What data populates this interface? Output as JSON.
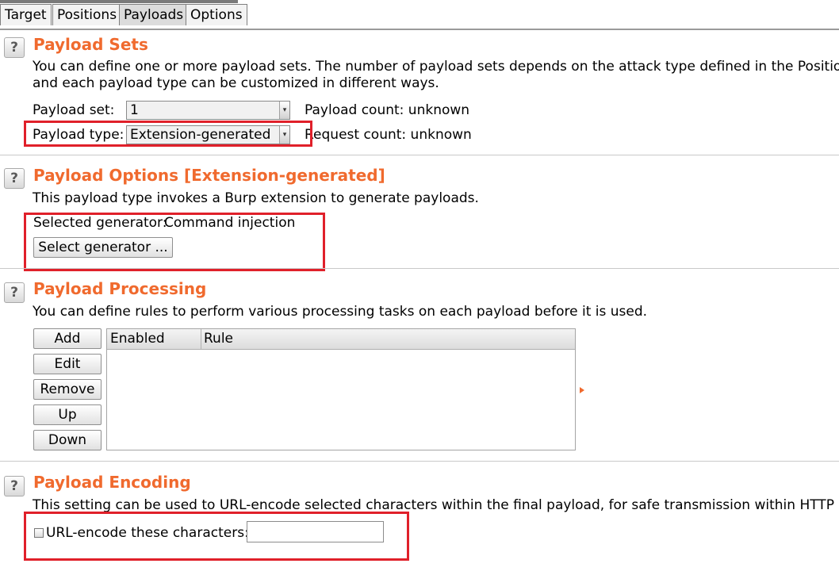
{
  "tabs": [
    "Target",
    "Positions",
    "Payloads",
    "Options"
  ],
  "active_tab": "Payloads",
  "help_label": "?",
  "payload_sets": {
    "title": "Payload Sets",
    "description_line1": "You can define one or more payload sets. The number of payload sets depends on the attack type defined in the Positions",
    "description_line2": "and each payload type can be customized in different ways.",
    "set_label": "Payload set:",
    "set_value": "1",
    "type_label": "Payload type:",
    "type_value": "Extension-generated",
    "payload_count": "Payload count: unknown",
    "request_count": "Request count: unknown"
  },
  "payload_options": {
    "title": "Payload Options [Extension-generated]",
    "description": "This payload type invokes a Burp extension to generate payloads.",
    "selected_generator_label": "Selected generator:",
    "selected_generator_value": "Command injection",
    "select_button": "Select generator ..."
  },
  "payload_processing": {
    "title": "Payload Processing",
    "description": "You can define rules to perform various processing tasks on each payload before it is used.",
    "buttons": [
      "Add",
      "Edit",
      "Remove",
      "Up",
      "Down"
    ],
    "columns": [
      "Enabled",
      "Rule"
    ]
  },
  "payload_encoding": {
    "title": "Payload Encoding",
    "description": "This setting can be used to URL-encode selected characters within the final payload, for safe transmission within HTTP req",
    "checkbox_label": "URL-encode these characters:",
    "checkbox_checked": false,
    "characters_value": ""
  },
  "colors": {
    "section_title": "#f06a2e",
    "highlight_box": "#e0202a"
  }
}
